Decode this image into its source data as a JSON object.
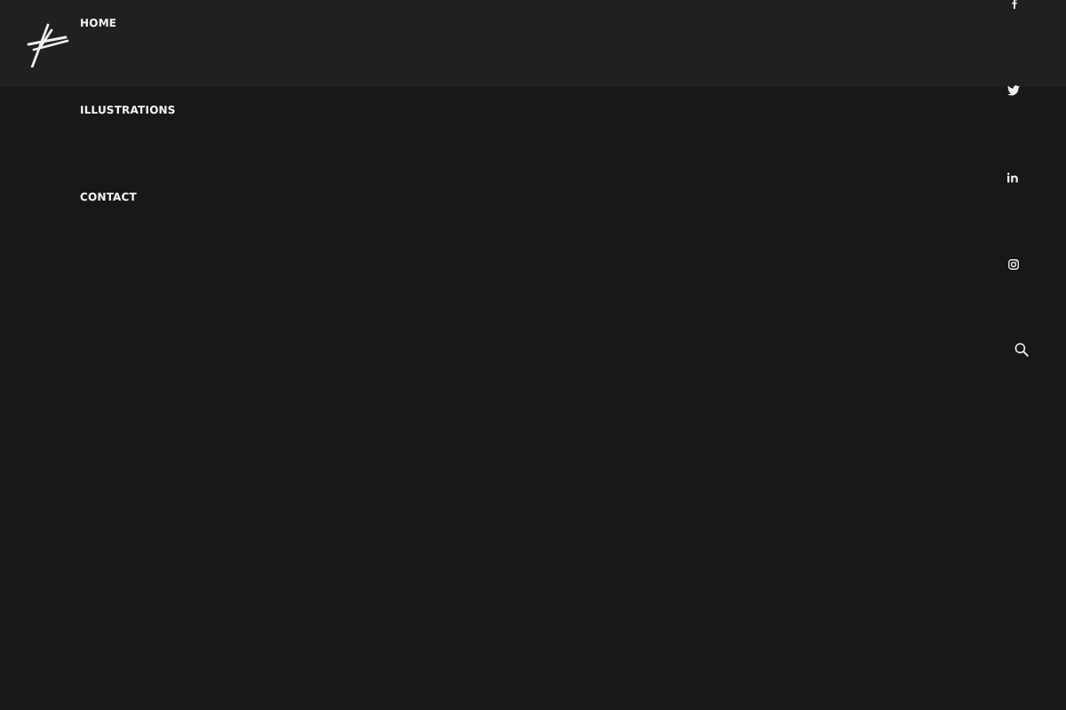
{
  "nav": [
    {
      "label": "HOME"
    },
    {
      "label": "ILLUSTRATIONS"
    },
    {
      "label": "CONTACT"
    }
  ],
  "social": [
    {
      "kind": "facebook"
    },
    {
      "kind": "twitter"
    },
    {
      "kind": "linkedin"
    },
    {
      "kind": "instagram"
    },
    {
      "kind": "search"
    }
  ]
}
